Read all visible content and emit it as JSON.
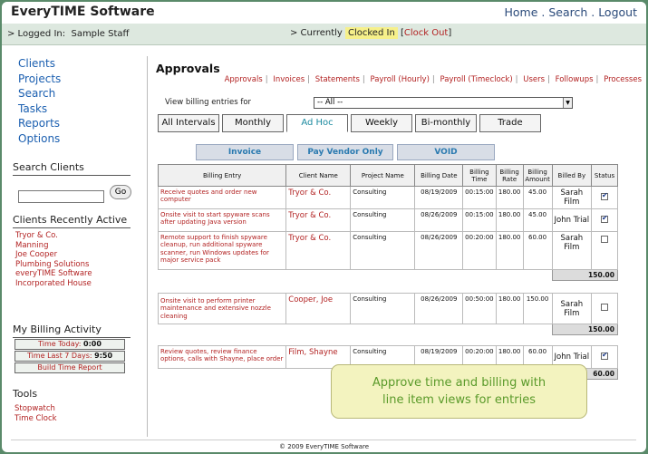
{
  "app": {
    "brand": "EveryTIME Software",
    "topnav": [
      "Home",
      "Search",
      "Logout"
    ]
  },
  "statusbar": {
    "logged_in_label": "> Logged In:",
    "user": "Sample Staff",
    "currently_label": "> Currently",
    "clock_status": "Clocked In",
    "clock_out": "Clock Out"
  },
  "sidebar": {
    "nav": [
      "Clients",
      "Projects",
      "Search",
      "Tasks",
      "Reports",
      "Options"
    ],
    "search_heading": "Search Clients",
    "search_value": "",
    "go_label": "Go",
    "recent_heading": "Clients Recently Active",
    "recent_clients": [
      "Tryor & Co.",
      "Manning",
      "Joe Cooper",
      "Plumbing Solutions",
      "everyTIME Software",
      "Incorporated House"
    ],
    "billing_heading": "My Billing Activity",
    "time_today_label": "Time Today:",
    "time_today_value": "0:00",
    "time_7days_label": "Time Last 7 Days:",
    "time_7days_value": "9:50",
    "build_report": "Build Time Report",
    "tools_heading": "Tools",
    "tools": [
      "Stopwatch",
      "Time Clock"
    ]
  },
  "main": {
    "title": "Approvals",
    "sublinks": [
      "Approvals",
      "Invoices",
      "Statements",
      "Payroll (Hourly)",
      "Payroll (Timeclock)",
      "Users",
      "Followups",
      "Processes"
    ],
    "filter_label": "View billing entries for",
    "filter_value": "-- All --",
    "tabs": [
      "All Intervals",
      "Monthly",
      "Ad Hoc",
      "Weekly",
      "Bi-monthly",
      "Trade"
    ],
    "active_tab": "Ad Hoc",
    "actions": [
      "Invoice",
      "Pay Vendor Only",
      "VOID"
    ],
    "columns": [
      "Billing Entry",
      "Client Name",
      "Project Name",
      "Billing Date",
      "Billing Time",
      "Billing Rate",
      "Billing Amount",
      "Billed By",
      "Status"
    ],
    "groups": [
      {
        "rows": [
          {
            "entry": "Receive quotes and order new computer",
            "client": "Tryor & Co.",
            "project": "Consulting",
            "date": "08/19/2009",
            "time": "00:15:00",
            "rate": "180.00",
            "amount": "45.00",
            "billed_by": "Sarah Film",
            "checked": true
          },
          {
            "entry": "Onsite visit to start spyware scans after updating Java version",
            "client": "Tryor & Co.",
            "project": "Consulting",
            "date": "08/26/2009",
            "time": "00:15:00",
            "rate": "180.00",
            "amount": "45.00",
            "billed_by": "John Trial",
            "checked": true
          },
          {
            "entry": "Remote support to finish spyware cleanup, run additional spyware scanner, run Windows updates for major service pack",
            "client": "Tryor & Co.",
            "project": "Consulting",
            "date": "08/26/2009",
            "time": "00:20:00",
            "rate": "180.00",
            "amount": "60.00",
            "billed_by": "Sarah Film",
            "checked": false
          }
        ],
        "total": "150.00"
      },
      {
        "rows": [
          {
            "entry": "Onsite visit to perform printer maintenance and extensive nozzle cleaning",
            "client": "Cooper, Joe",
            "project": "Consulting",
            "date": "08/26/2009",
            "time": "00:50:00",
            "rate": "180.00",
            "amount": "150.00",
            "billed_by": "Sarah Film",
            "checked": false
          }
        ],
        "total": "150.00"
      },
      {
        "rows": [
          {
            "entry": "Review quotes, review finance options, calls with Shayne, place order",
            "client": "Film, Shayne",
            "project": "Consulting",
            "date": "08/19/2009",
            "time": "00:20:00",
            "rate": "180.00",
            "amount": "60.00",
            "billed_by": "John Trial",
            "checked": true
          }
        ],
        "total": "60.00"
      }
    ]
  },
  "callout": {
    "line1": "Approve time and billing with",
    "line2": "line item views for entries"
  },
  "footer": "© 2009 EveryTIME Software"
}
